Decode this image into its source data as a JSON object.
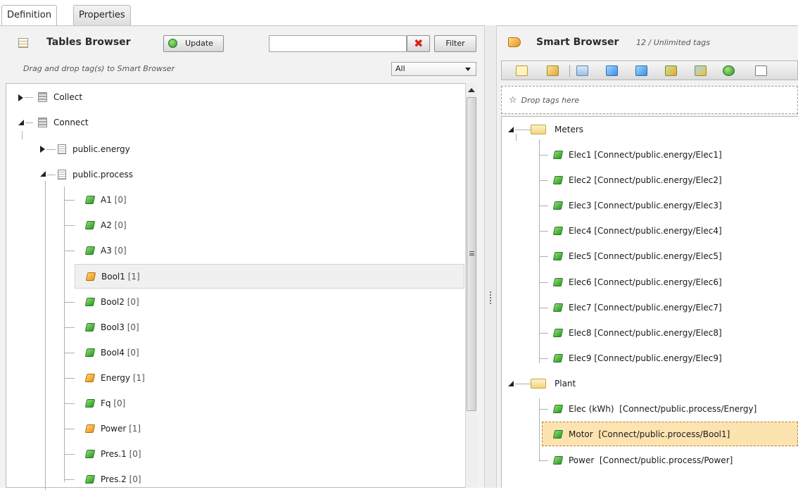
{
  "tabs": [
    {
      "label": "Definition"
    },
    {
      "label": "Properties"
    }
  ],
  "tables_browser": {
    "title": "Tables Browser",
    "update_label": "Update",
    "filter_value": "",
    "filter_label": "Filter",
    "hint": "Drag and drop tag(s) to Smart Browser",
    "type_select": "All",
    "items": [
      {
        "label": "Collect",
        "value": ""
      },
      {
        "label": "Connect",
        "value": ""
      },
      {
        "label": "public.energy",
        "value": ""
      },
      {
        "label": "public.process",
        "value": ""
      },
      {
        "label": "A1",
        "value": "[0]"
      },
      {
        "label": "A2",
        "value": "[0]"
      },
      {
        "label": "A3",
        "value": "[0]"
      },
      {
        "label": "Bool1",
        "value": "[1]"
      },
      {
        "label": "Bool2",
        "value": "[0]"
      },
      {
        "label": "Bool3",
        "value": "[0]"
      },
      {
        "label": "Bool4",
        "value": "[0]"
      },
      {
        "label": "Energy",
        "value": "[1]"
      },
      {
        "label": "Fq",
        "value": "[0]"
      },
      {
        "label": "Power",
        "value": "[1]"
      },
      {
        "label": "Pres.1",
        "value": "[0]"
      },
      {
        "label": "Pres.2",
        "value": "[0]"
      }
    ]
  },
  "smart_browser": {
    "title": "Smart Browser",
    "tag_count": "12 / Unlimited tags",
    "drop_hint": "Drop tags here",
    "groups": [
      {
        "label": "Meters",
        "items": [
          {
            "name": "Elec1",
            "path": "[Connect/public.energy/Elec1]"
          },
          {
            "name": "Elec2",
            "path": "[Connect/public.energy/Elec2]"
          },
          {
            "name": "Elec3",
            "path": "[Connect/public.energy/Elec3]"
          },
          {
            "name": "Elec4",
            "path": "[Connect/public.energy/Elec4]"
          },
          {
            "name": "Elec5",
            "path": "[Connect/public.energy/Elec5]"
          },
          {
            "name": "Elec6",
            "path": "[Connect/public.energy/Elec6]"
          },
          {
            "name": "Elec7",
            "path": "[Connect/public.energy/Elec7]"
          },
          {
            "name": "Elec8",
            "path": "[Connect/public.energy/Elec8]"
          },
          {
            "name": "Elec9",
            "path": "[Connect/public.energy/Elec9]"
          }
        ]
      },
      {
        "label": "Plant",
        "items": [
          {
            "name": "Elec (kWh)",
            "path": "[Connect/public.process/Energy]"
          },
          {
            "name": "Motor",
            "path": "[Connect/public.process/Bool1]"
          },
          {
            "name": "Power",
            "path": "[Connect/public.process/Power]"
          }
        ]
      }
    ]
  },
  "icons": {
    "tables_browser": "table-icon",
    "update": "refresh-icon",
    "clear": "clear-icon",
    "smart_browser": "tag-icon",
    "database": "database-icon",
    "table": "table-icon",
    "folder": "folder-icon",
    "tag": "tag-icon",
    "drop": "star-icon"
  },
  "colors": {
    "tag_good": "#2b9a2b",
    "tag_changed": "#e79415",
    "selected_row": "#fde3b0"
  }
}
